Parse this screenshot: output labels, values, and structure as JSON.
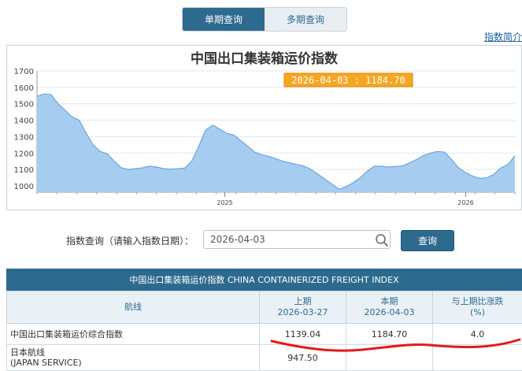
{
  "tabs": [
    {
      "label": "单期查询",
      "active": true
    },
    {
      "label": "多期查询",
      "active": false
    }
  ],
  "intro_link": "指数简介",
  "chart_data": {
    "type": "area",
    "title": "中国出口集装箱运价指数",
    "tooltip": "2026-04-03 : 1184.70",
    "ylim": [
      1000,
      1700
    ],
    "yticks": [
      1000,
      1100,
      1200,
      1300,
      1400,
      1500,
      1600,
      1700
    ],
    "xticks": [
      {
        "label": "2025",
        "pos": 0.393
      },
      {
        "label": "2026",
        "pos": 0.897
      }
    ],
    "grid": true,
    "fill_color": "#a6ccf0",
    "line_color": "#6aa6dc",
    "values": [
      1545,
      1560,
      1555,
      1500,
      1460,
      1420,
      1400,
      1320,
      1250,
      1210,
      1195,
      1150,
      1110,
      1100,
      1105,
      1110,
      1120,
      1115,
      1105,
      1102,
      1105,
      1108,
      1150,
      1240,
      1340,
      1370,
      1345,
      1320,
      1310,
      1275,
      1240,
      1205,
      1190,
      1180,
      1165,
      1150,
      1140,
      1130,
      1120,
      1100,
      1070,
      1040,
      1010,
      980,
      995,
      1020,
      1050,
      1090,
      1120,
      1120,
      1115,
      1118,
      1122,
      1140,
      1160,
      1185,
      1200,
      1210,
      1205,
      1160,
      1110,
      1080,
      1060,
      1045,
      1050,
      1070,
      1110,
      1130,
      1184.7
    ]
  },
  "query": {
    "label": "指数查询（请输入指数日期）：",
    "date_value": "2026-04-03",
    "button": "查询"
  },
  "table": {
    "header": "中国出口集装箱运价指数 CHINA CONTAINERIZED FREIGHT INDEX",
    "columns": [
      {
        "line1": "航线",
        "line2": ""
      },
      {
        "line1": "上期",
        "line2": "2026-03-27"
      },
      {
        "line1": "本期",
        "line2": "2026-04-03"
      },
      {
        "line1": "与上期比涨跌",
        "line2": "(%)"
      }
    ],
    "rows": [
      {
        "name": "中国出口集装箱运价综合指数",
        "prev": "1139.04",
        "curr": "1184.70",
        "change": "4.0"
      },
      {
        "name": "日本航线",
        "name2": "(JAPAN SERVICE)",
        "prev": "947.50",
        "curr": "",
        "change": ""
      }
    ]
  }
}
